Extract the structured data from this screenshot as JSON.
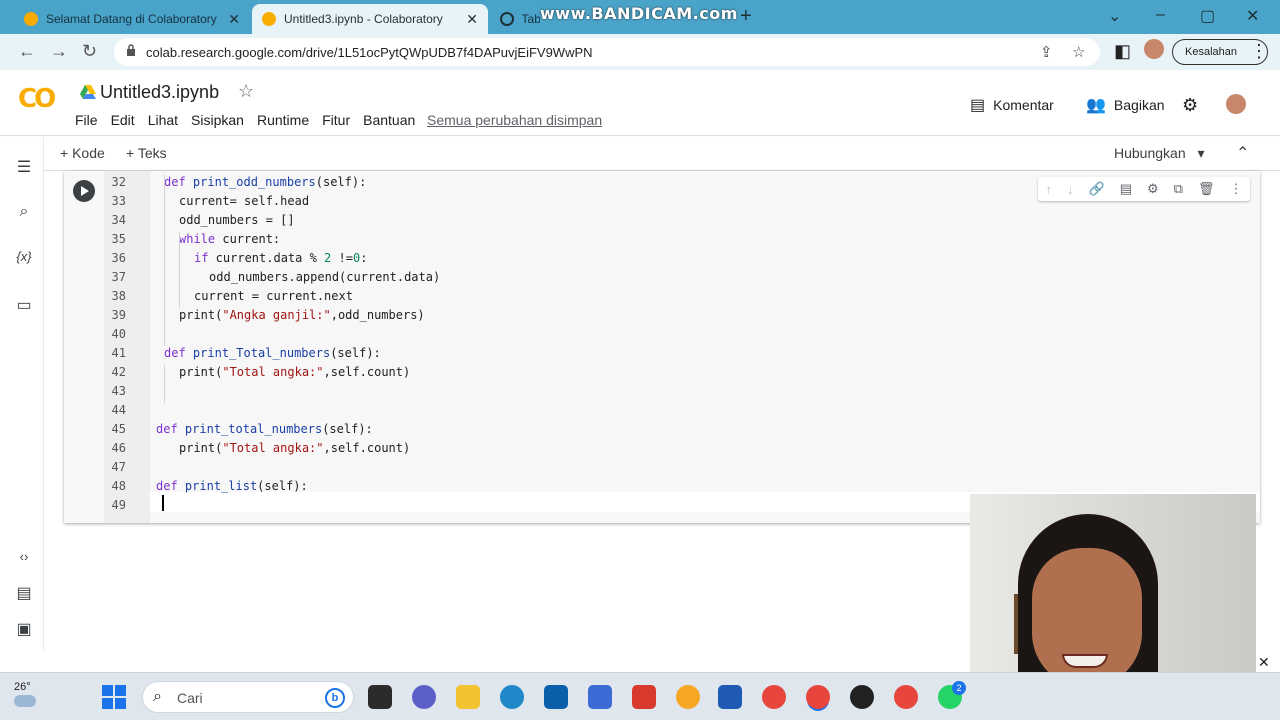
{
  "browser": {
    "tabs": [
      {
        "title": "Selamat Datang di Colaboratory",
        "active": false
      },
      {
        "title": "Untitled3.ipynb - Colaboratory",
        "active": true
      },
      {
        "title": "Tab",
        "active": false
      }
    ],
    "watermark": "www.BANDICAM.com",
    "url": "colab.research.google.com/drive/1L51ocPytQWpUDB7f4DAPuvjEiFV9WwPN",
    "error_chip": "Kesalahan"
  },
  "colab": {
    "notebook_title": "Untitled3.ipynb",
    "menu": [
      "File",
      "Edit",
      "Lihat",
      "Sisipkan",
      "Runtime",
      "Fitur",
      "Bantuan"
    ],
    "save_status": "Semua perubahan disimpan",
    "comment_label": "Komentar",
    "share_label": "Bagikan",
    "add_code_label": "+ Kode",
    "add_text_label": "+ Teks",
    "connect_label": "Hubungkan"
  },
  "code_lines": [
    {
      "n": "32",
      "text": "def print_odd_numbers(self):"
    },
    {
      "n": "33",
      "text": "current= self.head"
    },
    {
      "n": "34",
      "text": "odd_numbers = []"
    },
    {
      "n": "35",
      "text": "while current:"
    },
    {
      "n": "36",
      "text": "if current.data % 2 !=0:"
    },
    {
      "n": "37",
      "text": "odd_numbers.append(current.data)"
    },
    {
      "n": "38",
      "text": "current = current.next"
    },
    {
      "n": "39",
      "text": "print(\"Angka ganjil:\",odd_numbers)"
    },
    {
      "n": "40",
      "text": ""
    },
    {
      "n": "41",
      "text": "def print_Total_numbers(self):"
    },
    {
      "n": "42",
      "text": "print(\"Total angka:\",self.count)"
    },
    {
      "n": "43",
      "text": ""
    },
    {
      "n": "44",
      "text": ""
    },
    {
      "n": "45",
      "text": "def print_total_numbers(self):"
    },
    {
      "n": "46",
      "text": "print(\"Total angka:\",self.count)"
    },
    {
      "n": "47",
      "text": ""
    },
    {
      "n": "48",
      "text": "def print_list(self):"
    },
    {
      "n": "49",
      "text": ""
    }
  ],
  "taskbar": {
    "temperature": "26°",
    "search_placeholder": "Cari",
    "bing_label": "b",
    "badges": [
      "2"
    ]
  },
  "colors": {
    "tabbar": "#4aa3c8",
    "colab_orange": "#f9ab00",
    "keyword": "#7b30d0",
    "string": "#a31515"
  }
}
